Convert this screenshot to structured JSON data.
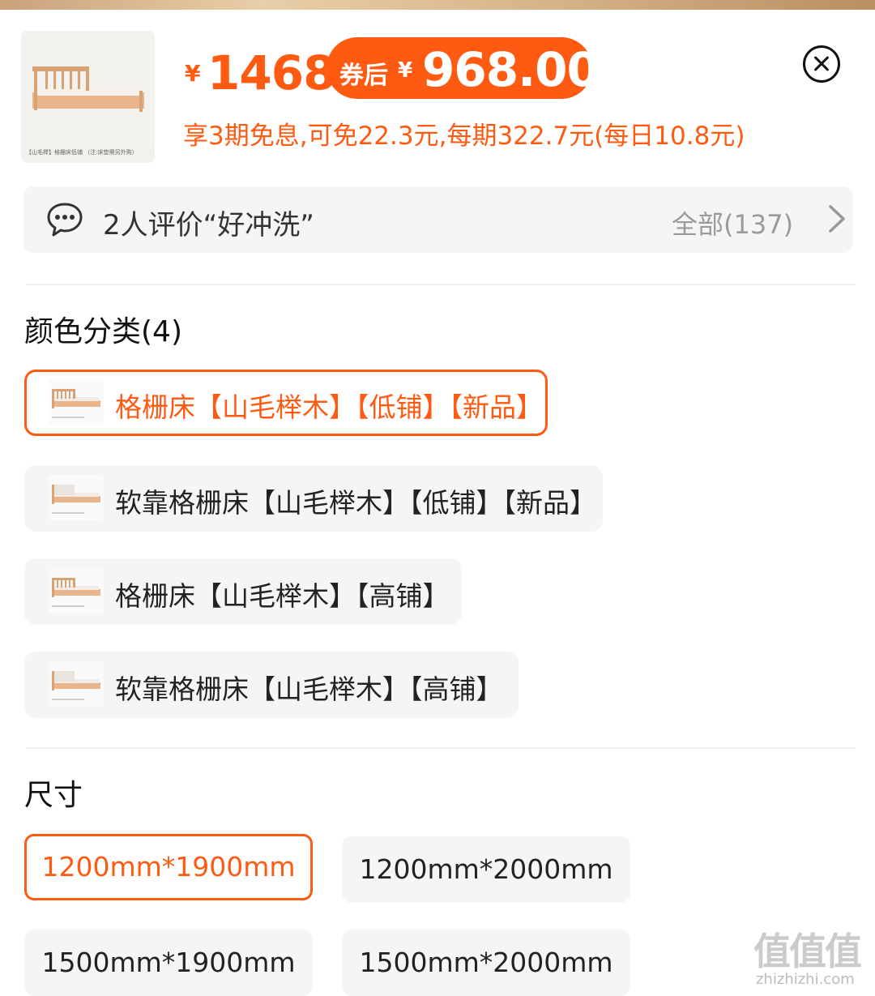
{
  "header": {
    "thumb_caption": "【山毛榉】格栅床低铺 （注:床垫需另外购）",
    "price_symbol": "¥",
    "price": "1468",
    "coupon_label": "券后",
    "coupon_symbol": "¥",
    "coupon_price": "968.00",
    "installment": "享3期免息,可免22.3元,每期322.7元(每日10.8元)"
  },
  "review": {
    "text": "2人评价“好冲洗”",
    "all": "全部(137)"
  },
  "color_section": {
    "title": "颜色分类(4)",
    "options": [
      {
        "label": "格栅床【山毛榉木】【低铺】【新品】"
      },
      {
        "label": "软靠格栅床【山毛榉木】【低铺】【新品】"
      },
      {
        "label": "格栅床【山毛榉木】【高铺】"
      },
      {
        "label": "软靠格栅床【山毛榉木】【高铺】"
      }
    ]
  },
  "size_section": {
    "title": "尺寸",
    "options": [
      {
        "label": "1200mm*1900mm"
      },
      {
        "label": "1200mm*2000mm"
      },
      {
        "label": "1500mm*1900mm"
      },
      {
        "label": "1500mm*2000mm"
      }
    ]
  },
  "watermark": {
    "logo": "值值值",
    "url": "zhizhizhi.com"
  },
  "colors": {
    "accent": "#ff5a12",
    "option_bg": "#f5f5f5"
  },
  "state": {
    "selected_color_index": 0,
    "selected_size_index": 0
  }
}
